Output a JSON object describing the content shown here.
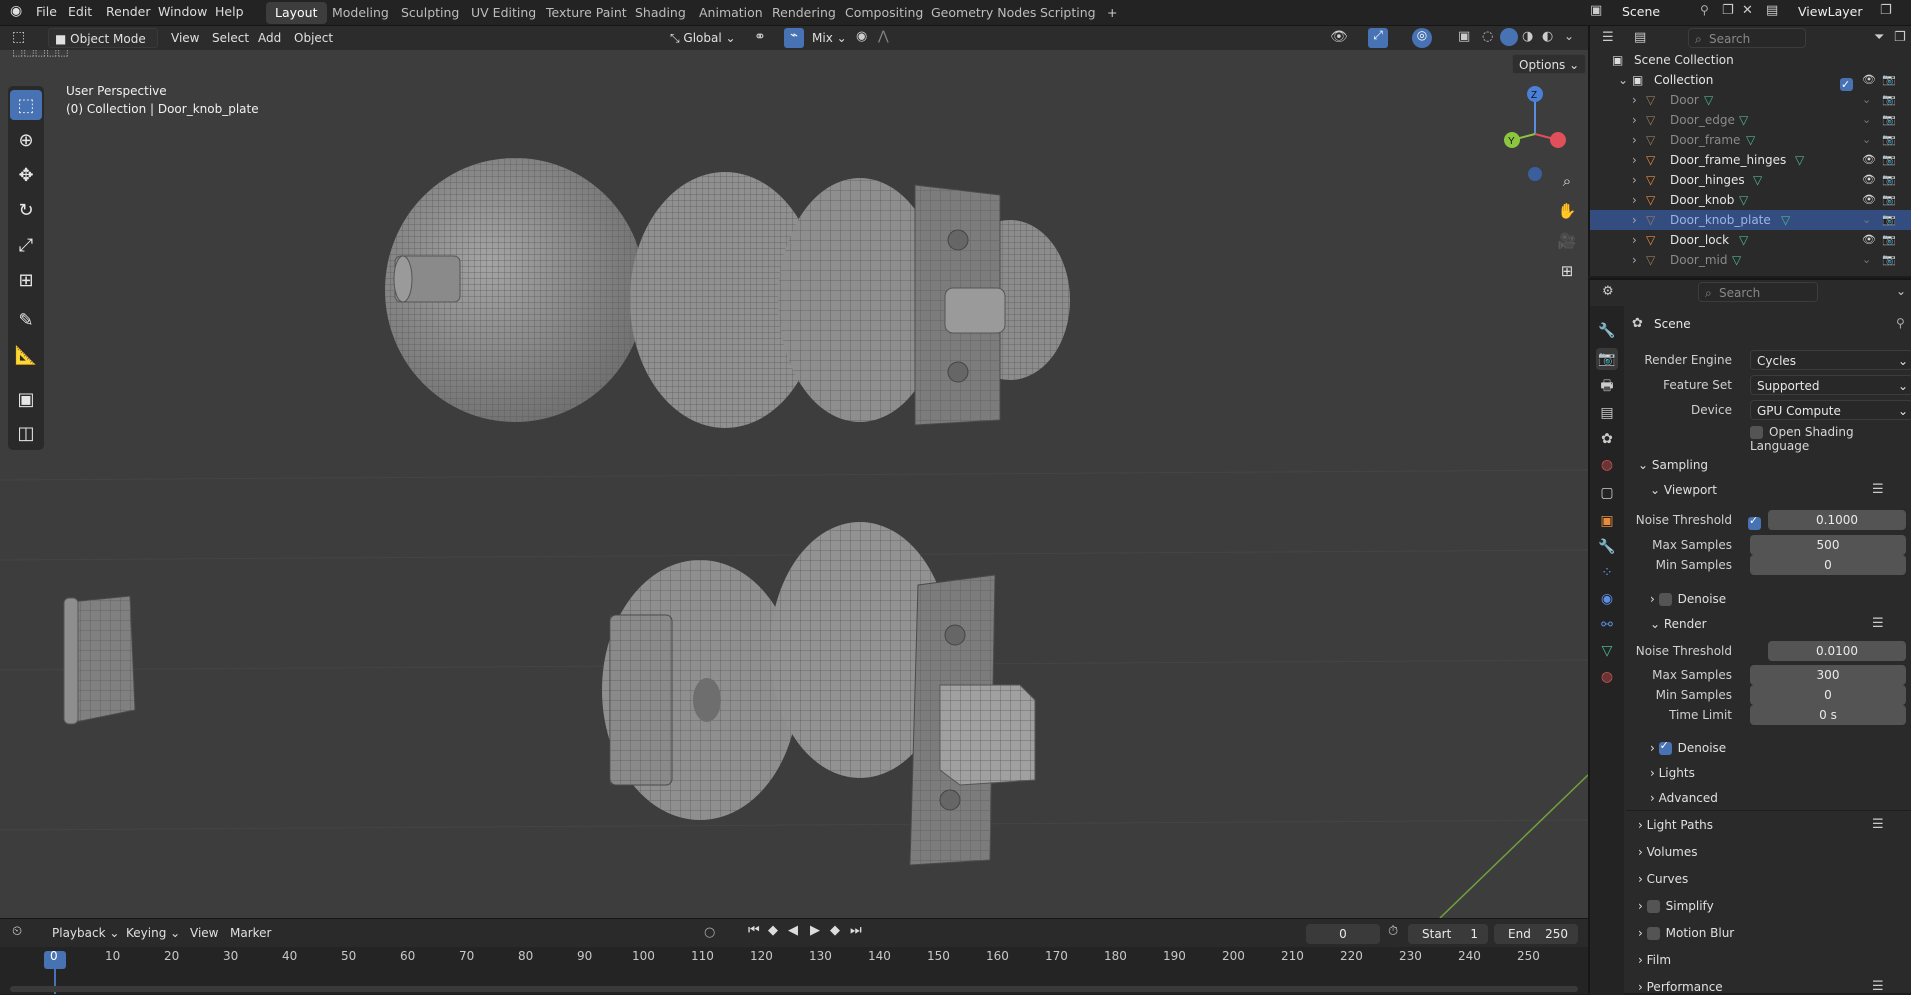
{
  "menubar": {
    "items": [
      "File",
      "Edit",
      "Render",
      "Window",
      "Help"
    ],
    "workspaces": [
      "Layout",
      "Modeling",
      "Sculpting",
      "UV Editing",
      "Texture Paint",
      "Shading",
      "Animation",
      "Rendering",
      "Compositing",
      "Geometry Nodes",
      "Scripting"
    ],
    "active_workspace": "Layout",
    "add_tab": "+",
    "scene": "Scene",
    "view_layer": "ViewLayer"
  },
  "viewport_header": {
    "mode": "Object Mode",
    "menus": [
      "View",
      "Select",
      "Add",
      "Object"
    ],
    "orientation": "Global",
    "snap_mode": "Mix",
    "options": "Options"
  },
  "viewport": {
    "perspective_label": "User Perspective",
    "collection_label": "(0) Collection | Door_knob_plate",
    "gizmo_axes": {
      "x": "X",
      "y": "Y",
      "z": "Z"
    }
  },
  "timeline": {
    "menus": [
      "Playback",
      "Keying",
      "View",
      "Marker"
    ],
    "current_frame": "0",
    "start_label": "Start",
    "start": "1",
    "end_label": "End",
    "end": "250",
    "ticks": [
      "0",
      "10",
      "20",
      "30",
      "40",
      "50",
      "60",
      "70",
      "80",
      "90",
      "100",
      "110",
      "120",
      "130",
      "140",
      "150",
      "160",
      "170",
      "180",
      "190",
      "200",
      "210",
      "220",
      "230",
      "240",
      "250"
    ]
  },
  "outliner": {
    "search_placeholder": "Search",
    "scene_collection": "Scene Collection",
    "collection": "Collection",
    "objects": [
      {
        "name": "Door",
        "visible": false,
        "selected": false
      },
      {
        "name": "Door_edge",
        "visible": false,
        "selected": false
      },
      {
        "name": "Door_frame",
        "visible": false,
        "selected": false
      },
      {
        "name": "Door_frame_hinges",
        "visible": true,
        "selected": false
      },
      {
        "name": "Door_hinges",
        "visible": true,
        "selected": false
      },
      {
        "name": "Door_knob",
        "visible": true,
        "selected": false
      },
      {
        "name": "Door_knob_plate",
        "visible": false,
        "selected": true
      },
      {
        "name": "Door_lock",
        "visible": true,
        "selected": false
      },
      {
        "name": "Door_mid",
        "visible": false,
        "selected": false
      }
    ]
  },
  "properties": {
    "search_placeholder": "Search",
    "context": "Scene",
    "render_engine_label": "Render Engine",
    "render_engine": "Cycles",
    "feature_set_label": "Feature Set",
    "feature_set": "Supported",
    "device_label": "Device",
    "device": "GPU Compute",
    "osl_label": "Open Shading Language",
    "sampling": "Sampling",
    "viewport": {
      "title": "Viewport",
      "noise_threshold_label": "Noise Threshold",
      "noise_threshold": "0.1000",
      "max_samples_label": "Max Samples",
      "max_samples": "500",
      "min_samples_label": "Min Samples",
      "min_samples": "0",
      "denoise_label": "Denoise"
    },
    "render": {
      "title": "Render",
      "noise_threshold_label": "Noise Threshold",
      "noise_threshold": "0.0100",
      "max_samples_label": "Max Samples",
      "max_samples": "300",
      "min_samples_label": "Min Samples",
      "min_samples": "0",
      "time_limit_label": "Time Limit",
      "time_limit": "0 s",
      "denoise_label": "Denoise"
    },
    "subpanels": [
      "Lights",
      "Advanced"
    ],
    "panels": [
      "Light Paths",
      "Volumes",
      "Curves",
      "Simplify",
      "Motion Blur",
      "Film",
      "Performance"
    ]
  },
  "colors": {
    "accent": "#4772b3",
    "viewport_bg": "#3d3d3d",
    "panel_bg": "#2a2a2a",
    "mesh_icon": "#4fb58f",
    "object_icon": "#e88c3a"
  }
}
